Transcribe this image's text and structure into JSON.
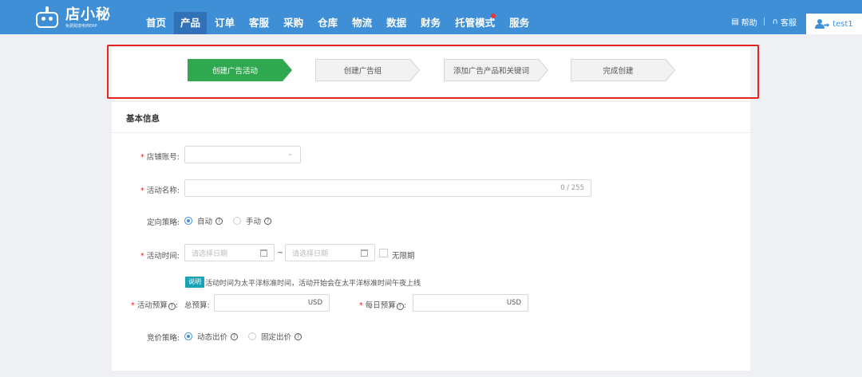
{
  "app": {
    "logo_name": "店小秘",
    "logo_sub": "免费跨境电商ERP",
    "nav": [
      {
        "label": "首页"
      },
      {
        "label": "产品"
      },
      {
        "label": "订单"
      },
      {
        "label": "客服"
      },
      {
        "label": "采购"
      },
      {
        "label": "仓库"
      },
      {
        "label": "物流"
      },
      {
        "label": "数据"
      },
      {
        "label": "财务"
      },
      {
        "label": "托管模式"
      },
      {
        "label": "服务"
      }
    ],
    "active_nav": "产品",
    "help_label": "帮助",
    "service_label": "客服",
    "user_name": "test1"
  },
  "steps": [
    {
      "label": "创建广告活动",
      "status": "current"
    },
    {
      "label": "创建广告组",
      "status": "pending"
    },
    {
      "label": "添加广告产品和关键词",
      "status": "pending"
    },
    {
      "label": "完成创建",
      "status": "pending"
    }
  ],
  "form": {
    "section_title": "基本信息",
    "store_label": "店铺账号:",
    "store_value": "",
    "name_label": "活动名称:",
    "name_counter": "0 / 255",
    "strategy_label": "定向策略:",
    "strategy_options": [
      "自动",
      "手动"
    ],
    "strategy_selected": "自动",
    "time_label": "活动时间:",
    "start_placeholder": "请选择日期",
    "time_sep": "~",
    "end_placeholder": "请选择日期",
    "no_end_label": "无限期",
    "tip_badge": "说明",
    "tip_text": "活动时间为太平洋标准时间，活动开始会在太平洋标准时间午夜上线",
    "budget_label": "活动预算",
    "total_budget_label": "总预算:",
    "total_budget_unit": "USD",
    "daily_budget_label": "每日预算",
    "daily_budget_unit": "USD",
    "bid_label": "竞价策略:",
    "bid_options": [
      "动态出价",
      "固定出价"
    ],
    "bid_selected": "动态出价"
  },
  "colors": {
    "header": "#3f8fd6",
    "active_step": "#2fa84f",
    "highlight_frame": "#e8221e",
    "tip_badge": "#1aa3b6"
  }
}
